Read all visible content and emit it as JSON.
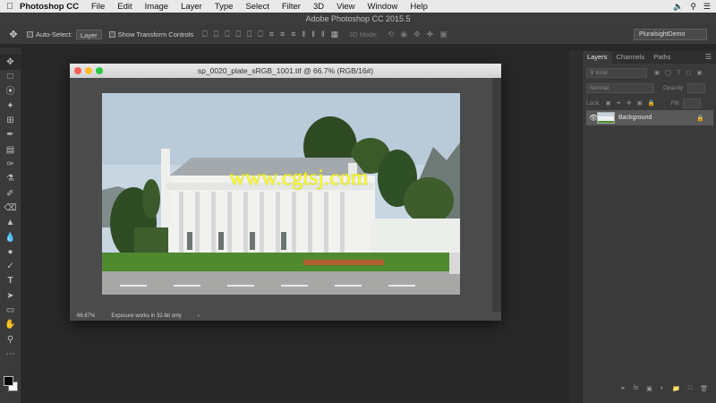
{
  "menubar": {
    "app_name": "Photoshop CC",
    "items": [
      "File",
      "Edit",
      "Image",
      "Layer",
      "Type",
      "Select",
      "Filter",
      "3D",
      "View",
      "Window",
      "Help"
    ]
  },
  "app_title": "Adobe Photoshop CC 2015.5",
  "options": {
    "auto_select_label": "Auto-Select:",
    "auto_select_value": "Layer",
    "transform_label": "Show Transform Controls",
    "mode_label": "3D Mode:",
    "workspace": "PluralsightDemo"
  },
  "document": {
    "title": "sp_0020_plate_sRGB_1001.tif @ 66.7% (RGB/16#)",
    "zoom": "66.67%",
    "status": "Exposure works in 32-bit only",
    "watermark": "www.cgtsj.com"
  },
  "layers_panel": {
    "tabs": [
      "Layers",
      "Channels",
      "Paths"
    ],
    "kind_label": "Kind",
    "blend_mode": "Normal",
    "opacity_label": "Opacity:",
    "lock_label": "Lock:",
    "fill_label": "Fill:",
    "layer_name": "Background"
  },
  "colors": {
    "watermark": "#ffff20",
    "panel_bg": "#3a3a3a",
    "selected_layer": "#595959"
  }
}
